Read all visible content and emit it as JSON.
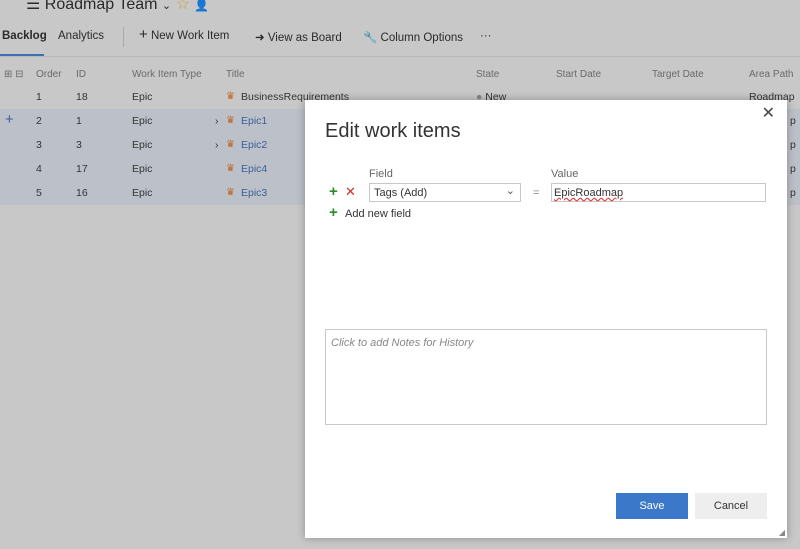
{
  "header": {
    "team": "Roadmap Team"
  },
  "tabs": [
    {
      "label": "Backlog"
    },
    {
      "label": "Analytics"
    }
  ],
  "toolbar": {
    "new_item": "New Work Item",
    "view_board": "View as Board",
    "column_options": "Column Options",
    "more": "···"
  },
  "columns": [
    "Order",
    "ID",
    "Work Item Type",
    "Title",
    "State",
    "Start Date",
    "Target Date",
    "Area Path"
  ],
  "rows": [
    {
      "order": "1",
      "id": "18",
      "type": "Epic",
      "title": "BusinessRequirements",
      "state": "New",
      "area": "Roadmap"
    },
    {
      "order": "2",
      "id": "1",
      "type": "Epic",
      "title": "Epic1",
      "area": "p"
    },
    {
      "order": "3",
      "id": "3",
      "type": "Epic",
      "title": "Epic2",
      "area": "p"
    },
    {
      "order": "4",
      "id": "17",
      "type": "Epic",
      "title": "Epic4",
      "area": "p"
    },
    {
      "order": "5",
      "id": "16",
      "type": "Epic",
      "title": "Epic3",
      "area": "p"
    }
  ],
  "dialog": {
    "title": "Edit work items",
    "field_label": "Field",
    "value_label": "Value",
    "field_value": "Tags (Add)",
    "equals": "=",
    "value": "EpicRoadmap",
    "add_field": "Add new field",
    "notes_placeholder": "Click to add Notes for History",
    "save": "Save",
    "cancel": "Cancel"
  },
  "colors": {
    "accent": "#3b78c9",
    "add": "#2e8b2e",
    "remove": "#d03020"
  }
}
